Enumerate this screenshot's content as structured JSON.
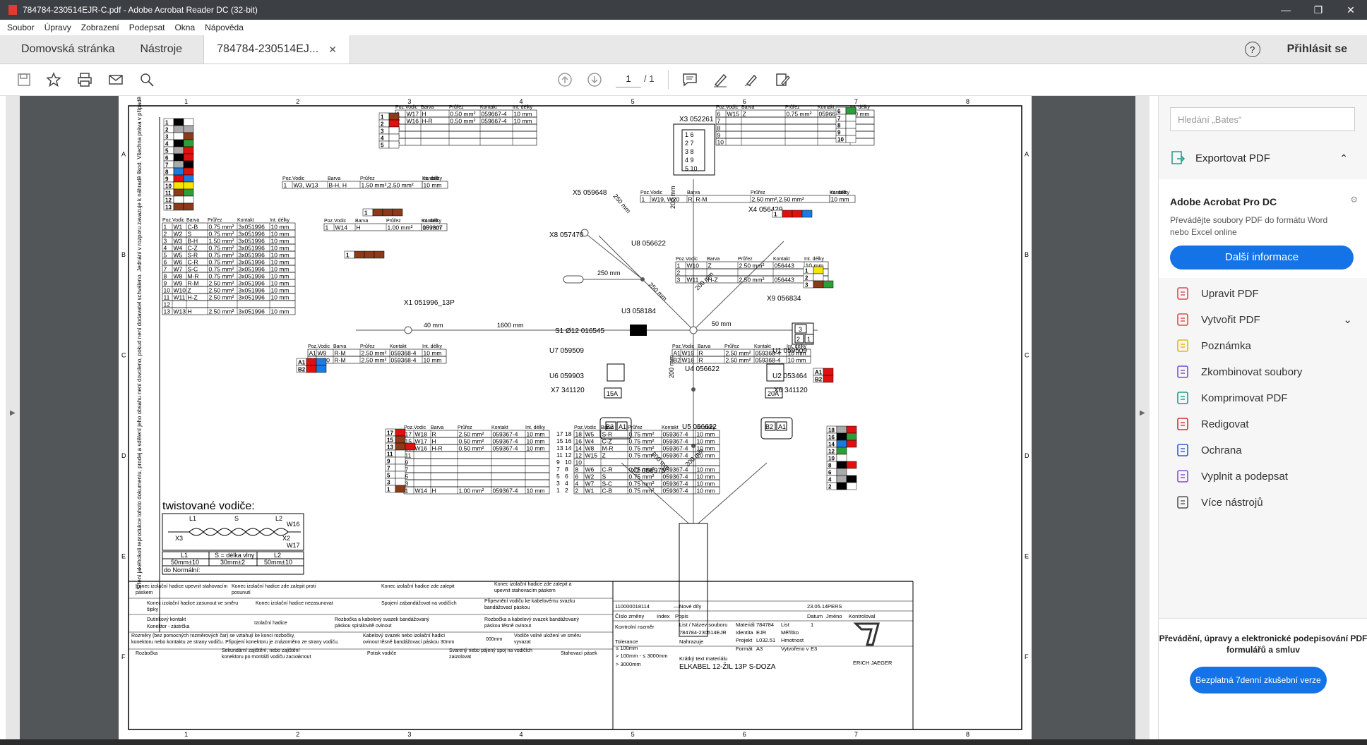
{
  "window": {
    "title": "784784-230514EJR-C.pdf - Adobe Acrobat Reader DC (32-bit)"
  },
  "menu": [
    "Soubor",
    "Úpravy",
    "Zobrazení",
    "Podepsat",
    "Okna",
    "Nápověda"
  ],
  "tabs": {
    "home": "Domovská stránka",
    "tools": "Nástroje",
    "doc": "784784-230514EJ...",
    "signin": "Přihlásit se"
  },
  "toolbar": {
    "page_current": "1",
    "page_total": "/ 1"
  },
  "right_panel": {
    "search_placeholder": "Hledání „Bates“",
    "export": "Exportovat PDF",
    "promo_title": "Adobe Acrobat Pro DC",
    "promo_desc": "Převádějte soubory PDF do formátu Word nebo Excel online",
    "promo_button": "Další informace",
    "tools": [
      "Upravit PDF",
      "Vytvořit PDF",
      "Poznámka",
      "Zkombinovat soubory",
      "Komprimovat PDF",
      "Redigovat",
      "Ochrana",
      "Vyplnit a podepsat",
      "Více nástrojů"
    ],
    "tool_icons": [
      "edit-pdf-icon",
      "create-pdf-icon",
      "comment-icon",
      "combine-icon",
      "compress-icon",
      "redact-icon",
      "protect-icon",
      "fill-sign-icon",
      "more-tools-icon"
    ],
    "bottom_text": "Převádění, úpravy a elektronické podepisování PDF formulářů a smluv",
    "bottom_button": "Bezplatná 7denní zkušební verze"
  },
  "drawing": {
    "columns": [
      "1",
      "2",
      "3",
      "4",
      "5",
      "6",
      "7",
      "8"
    ],
    "rows": [
      "A",
      "B",
      "C",
      "D",
      "E",
      "F"
    ],
    "connectors": {
      "x3": "X3  052261",
      "x5": "X5  059648",
      "x4": "X4  056429",
      "x8": "X8  057470",
      "u8": "U8  056622",
      "x1": "X1  051996_13P",
      "u3": "U3  058184",
      "s1": "S1  Ø12  016545",
      "x9": "X9  056834",
      "u7": "U7  059509",
      "u1": "U1  059509",
      "u6": "U6  059903",
      "u4": "U4  056622",
      "u2": "U2  053464",
      "x7": "X7  341120",
      "x6": "X6  341120",
      "u5": "U5  056622",
      "x2": "X2  056975"
    },
    "lengths": {
      "l200a": "200 mm",
      "l250a": "250 mm",
      "l250b": "250 mm",
      "l250c": "250 mm",
      "l200b": "200 mm",
      "l1600": "1600 mm",
      "l40": "40 mm",
      "l50": "50 mm",
      "l200c": "200 mm",
      "l200d": "200 mm",
      "l200e": "200 mm"
    },
    "fuses": {
      "f1": "15A",
      "f2": "20A"
    },
    "table_header": [
      "Poz.",
      "Vodic",
      "Barva",
      "Průřez",
      "Kontakt",
      "Int. délky"
    ],
    "x1_rows": [
      [
        "1",
        "W1",
        "C-B",
        "0.75 mm²",
        "3x051996",
        "10 mm"
      ],
      [
        "2",
        "W2",
        "S",
        "0.75 mm²",
        "3x051996",
        "10 mm"
      ],
      [
        "3",
        "W3",
        "B-H",
        "1.50 mm²",
        "3x051996",
        "10 mm"
      ],
      [
        "4",
        "W4",
        "C-Z",
        "0.75 mm²",
        "3x051996",
        "10 mm"
      ],
      [
        "5",
        "W5",
        "S-R",
        "0.75 mm²",
        "3x051996",
        "10 mm"
      ],
      [
        "6",
        "W6",
        "C-R",
        "0.75 mm²",
        "3x051996",
        "10 mm"
      ],
      [
        "7",
        "W7",
        "S-C",
        "0.75 mm²",
        "3x051996",
        "10 mm"
      ],
      [
        "8",
        "W8",
        "M-R",
        "0.75 mm²",
        "3x051996",
        "10 mm"
      ],
      [
        "9",
        "W9",
        "R-M",
        "2.50 mm²",
        "3x051996",
        "10 mm"
      ],
      [
        "10",
        "W10",
        "Z",
        "2.50 mm²",
        "3x051996",
        "10 mm"
      ],
      [
        "11",
        "W11",
        "H-Z",
        "2.50 mm²",
        "3x051996",
        "10 mm"
      ],
      [
        "12",
        "",
        "",
        "",
        "",
        ""
      ],
      [
        "13",
        "W13",
        "H",
        "2.50 mm²",
        "3x051996",
        "10 mm"
      ]
    ],
    "x3_rows": [
      [
        "1",
        "W17",
        "H",
        "0.50 mm²",
        "059667-4",
        "10 mm"
      ],
      [
        "2",
        "W16",
        "H-R",
        "0.50 mm²",
        "059667-4",
        "10 mm"
      ],
      [
        "3",
        "",
        "",
        "",
        "",
        ""
      ],
      [
        "4",
        "",
        "",
        "",
        "",
        ""
      ],
      [
        "5",
        "",
        "",
        "",
        "",
        ""
      ]
    ],
    "x3_right_rows": [
      [
        "6",
        "W15",
        "Z",
        "0.75 mm²",
        "059667-4",
        "10 mm"
      ],
      [
        "7",
        "",
        "",
        "",
        "",
        ""
      ],
      [
        "8",
        "",
        "",
        "",
        "",
        ""
      ],
      [
        "9",
        "",
        "",
        "",
        "",
        ""
      ],
      [
        "10",
        "",
        "",
        "",
        "",
        ""
      ]
    ],
    "x5_row": [
      "1",
      "W3, W13",
      "B-H, H",
      "1.50 mm²,2.50 mm²",
      "",
      "10 mm"
    ],
    "x8_row": [
      "1",
      "W14",
      "H",
      "1.00 mm²",
      "059307",
      "10 mm"
    ],
    "x4_row": [
      "1",
      "W19, W20",
      "R, R-M",
      "2.50 mm²,2.50 mm²",
      "",
      "10 mm"
    ],
    "x9_rows": [
      [
        "1",
        "W10",
        "Z",
        "2.50 mm²",
        "056443",
        "10 mm"
      ],
      [
        "2",
        "",
        "",
        "",
        "",
        ""
      ],
      [
        "3",
        "W11",
        "H-Z",
        "2.50 mm²",
        "056443",
        "10 mm"
      ]
    ],
    "x7_rows": [
      [
        "A1",
        "W9",
        "R-M",
        "2.50 mm²",
        "059368-4",
        "10 mm"
      ],
      [
        "B2",
        "W20",
        "R-M",
        "2.50 mm²",
        "059368-4",
        "10 mm"
      ]
    ],
    "x6_rows": [
      [
        "A1",
        "W19",
        "R",
        "2.50 mm²",
        "059368-4",
        "10 mm"
      ],
      [
        "B2",
        "W18",
        "R",
        "2.50 mm²",
        "059368-4",
        "10 mm"
      ]
    ],
    "x2_left_rows": [
      [
        "17",
        "W18",
        "R",
        "2.50 mm²",
        "059367-4",
        "10 mm"
      ],
      [
        "15",
        "W17",
        "H",
        "0.50 mm²",
        "059367-4",
        "10 mm"
      ],
      [
        "13",
        "W16",
        "H-R",
        "0.50 mm²",
        "059367-4",
        "10 mm"
      ],
      [
        "11",
        "",
        "",
        "",
        "",
        ""
      ],
      [
        "9",
        "",
        "",
        "",
        "",
        ""
      ],
      [
        "7",
        "",
        "",
        "",
        "",
        ""
      ],
      [
        "5",
        "",
        "",
        "",
        "",
        ""
      ],
      [
        "3",
        "",
        "",
        "",
        "",
        ""
      ],
      [
        "1",
        "W14",
        "H",
        "1.00 mm²",
        "059367-4",
        "10 mm"
      ]
    ],
    "x2_right_rows": [
      [
        "18",
        "W5",
        "S-R",
        "0.75 mm²",
        "059367-4",
        "10 mm"
      ],
      [
        "16",
        "W4",
        "C-Z",
        "0.75 mm²",
        "059367-4",
        "10 mm"
      ],
      [
        "14",
        "W8",
        "M-R",
        "0.75 mm²",
        "059367-4",
        "10 mm"
      ],
      [
        "12",
        "W15",
        "Z",
        "0.75 mm²",
        "059367-4",
        "10 mm"
      ],
      [
        "10",
        "",
        "",
        "",
        "",
        ""
      ],
      [
        "8",
        "W6",
        "C-R",
        "0.75 mm²",
        "059367-4",
        "10 mm"
      ],
      [
        "6",
        "W2",
        "S",
        "0.75 mm²",
        "059367-4",
        "10 mm"
      ],
      [
        "4",
        "W7",
        "S-C",
        "0.75 mm²",
        "059367-4",
        "10 mm"
      ],
      [
        "2",
        "W1",
        "C-B",
        "0.75 mm²",
        "059367-4",
        "10 mm"
      ]
    ],
    "twist": {
      "title": "twistované vodiče:",
      "L1": "L1",
      "S": "S",
      "L2": "L2",
      "X3": "X3",
      "X2": "X2",
      "W16": "W16",
      "W17": "W17",
      "h1": "L1",
      "h2": "S = délka vlny",
      "h3": "L2",
      "v1": "50mm±10",
      "v2": "30mm±2",
      "v3": "50mm±10",
      "normal": "do Normální:"
    },
    "side_note": "Šíření jakéhokoli reprodukce tohoto dokumentu, prodej a sdělení jeho obsahu není dovoleno, pokud není dodavatel schváleno. Jednání v rozporu zavazuje k náhradě škod. Všechna práva v případě udělení patentu nebo zapsání průmyslového vzoru jsou vyhrazena.",
    "legend": [
      "Konec izolační hadice upevnit stahovacím páskem",
      "Konec izolační hadice zde zalepit proti posunutí",
      "Konec izolační hadice zde zalepit",
      "Konec izolační hadice zde zalepit a upevnit stahovacím páskem",
      "Konec izolační hadice zasunout ve směru šipky",
      "Konec izolační hadice nezasunovat",
      "Spojení zabandážovat na vodičích",
      "Připevnění vodiču ke kabelovému svazku bandážovací páskou",
      "Dutinkový kontakt",
      "Konektor - zástrčka",
      "Izolační hadice",
      "Rozbočka a kabelový svazek bandážovaný páskou spirálovitě ovinout",
      "Rozbočka a kabelový svazek bandážovaný páskou těsně ovinout",
      "Rozměry (bez pomocných rozměrových čar) se vztahují ke konci rozbočky, konektoru nebo kontaktu ze strany vodiču.  Připojení konektoru je znázorněno ze strany vodiču.",
      "Kabelový svazek nebo izolační hadici ovinout těsně bandážovací páskou 30mm",
      "000mm",
      "Vodiče volné uložení ve směru vyvazat",
      "Rozbočka",
      "Sekundární zajištění, nebo zajištění konektoru po montáži vodiču zacvaknout",
      "Potisk vodiče",
      "Svarený nebo pájený spoj na vodičích zaizolovat",
      "Stahovací pásek"
    ],
    "titleblock": {
      "num": "110000018114",
      "newdata": "Nové díly",
      "date": "23.05.14",
      "pers": "PERS",
      "cz": "Číslo změny",
      "index": "Index",
      "popis": "Popis",
      "datum": "Datum",
      "jmeno": "Jméno",
      "kontrol": "Kontroloval",
      "kontrolni": "Kontrolní rozměr",
      "list_nazev": "List / Název souboru",
      "file": "784784-230514EJR",
      "material": "Materiál",
      "mat_v": "784784",
      "list": "List",
      "list_v": "1",
      "identita": "Identita",
      "ident_v": "EJR",
      "meritko": "Měřítko",
      "tolerance": "Tolerance",
      "nahrazuje": "Nahrazuje",
      "projekt": "Projekt",
      "proj_v": "L032.51",
      "hmotnost": "Hmotnost",
      "format": "Formát",
      "format_v": "A3",
      "vytvoreno": "Vytvořeno v",
      "vyt_v": "E3",
      "tol1": "≤ 100mm",
      "tol2": "> 100mm - ≤ 3000mm",
      "tol3": "> 3000mm",
      "kratky": "Krátký text materiálu",
      "name": "ELKABEL 12-ŽIL 13P S-DOZA",
      "logo": "ERICH JAEGER"
    }
  }
}
